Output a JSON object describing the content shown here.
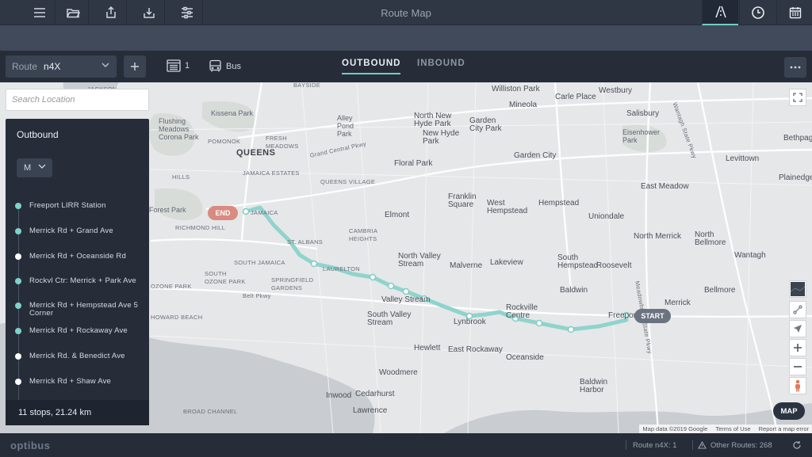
{
  "toolbar": {
    "title": "Route Map",
    "icons": [
      "menu-icon",
      "folder-open-icon",
      "export-icon",
      "download-icon",
      "sliders-icon",
      "route-icon",
      "clock-icon",
      "calendar-icon"
    ]
  },
  "route_bar": {
    "route_label": "Route",
    "route_value": "n4X",
    "trips_count": "1",
    "vehicle_type": "Bus",
    "tabs": [
      "OUTBOUND",
      "INBOUND"
    ],
    "active_tab": "OUTBOUND"
  },
  "search": {
    "placeholder": "Search Location"
  },
  "stops_panel": {
    "title": "Outbound",
    "day": "M",
    "stops": [
      {
        "name": "Freeport LIRR Station",
        "color": "teal"
      },
      {
        "name": "Merrick Rd + Grand Ave",
        "color": "teal"
      },
      {
        "name": "Merrick Rd + Oceanside Rd",
        "color": "white"
      },
      {
        "name": "Rockvl Ctr: Merrick + Park Ave",
        "color": "teal"
      },
      {
        "name": "Merrick Rd + Hempstead Ave 5 Corner",
        "color": "teal"
      },
      {
        "name": "Merrick Rd + Rockaway Ave",
        "color": "teal"
      },
      {
        "name": "Merrick Rd. & Benedict Ave",
        "color": "white"
      },
      {
        "name": "Merrick Rd + Shaw Ave",
        "color": "white"
      }
    ],
    "summary": "11 stops, 21.24 km"
  },
  "map": {
    "end_label": "END",
    "start_label": "START",
    "toggle_label": "MAP",
    "attribution": [
      "Map data ©2019 Google",
      "Terms of Use",
      "Report a map error"
    ],
    "places": [
      {
        "text": "JACKSON",
        "cls": "small"
      },
      {
        "text": "BAYSIDE",
        "cls": "small"
      },
      {
        "text": "Williston Park",
        "cls": "town"
      },
      {
        "text": "Westbury",
        "cls": "town"
      },
      {
        "text": "Mineola",
        "cls": "town"
      },
      {
        "text": "Carle Place",
        "cls": "town"
      },
      {
        "text": "Kissena Park",
        "cls": ""
      },
      {
        "text": "Flushing Meadows Corona Park",
        "cls": ""
      },
      {
        "text": "Alley Pond Park",
        "cls": ""
      },
      {
        "text": "North New Hyde Park",
        "cls": "town"
      },
      {
        "text": "Garden City Park",
        "cls": "town"
      },
      {
        "text": "New Hyde Park",
        "cls": "town"
      },
      {
        "text": "Salisbury",
        "cls": "town"
      },
      {
        "text": "Eisenhower Park",
        "cls": ""
      },
      {
        "text": "Bethpage",
        "cls": "town"
      },
      {
        "text": "POMONOK",
        "cls": "small"
      },
      {
        "text": "FRESH MEADOWS",
        "cls": "small"
      },
      {
        "text": "QUEENS",
        "cls": "bold"
      },
      {
        "text": "JAMAICA ESTATES",
        "cls": "small"
      },
      {
        "text": "Garden City",
        "cls": "town"
      },
      {
        "text": "Floral Park",
        "cls": "town"
      },
      {
        "text": "Levittown",
        "cls": "town"
      },
      {
        "text": "HILLS",
        "cls": "small"
      },
      {
        "text": "QUEENS VILLAGE",
        "cls": "small"
      },
      {
        "text": "East Meadow",
        "cls": "town"
      },
      {
        "text": "Franklin Square",
        "cls": "town"
      },
      {
        "text": "West Hempstead",
        "cls": "town"
      },
      {
        "text": "Hempstead",
        "cls": "town"
      },
      {
        "text": "Uniondale",
        "cls": "town"
      },
      {
        "text": "Plainedge",
        "cls": "town"
      },
      {
        "text": "Forest Park",
        "cls": ""
      },
      {
        "text": "JAMAICA",
        "cls": "small"
      },
      {
        "text": "Elmont",
        "cls": "town"
      },
      {
        "text": "RICHMOND HILL",
        "cls": "small"
      },
      {
        "text": "CAMBRIA HEIGHTS",
        "cls": "small"
      },
      {
        "text": "North Merrick",
        "cls": "town"
      },
      {
        "text": "North Bellmore",
        "cls": "town"
      },
      {
        "text": "ST. ALBANS",
        "cls": "small"
      },
      {
        "text": "Wantagh",
        "cls": "town"
      },
      {
        "text": "North Valley Stream",
        "cls": "town"
      },
      {
        "text": "Malverne",
        "cls": "town"
      },
      {
        "text": "Lakeview",
        "cls": "town"
      },
      {
        "text": "South Hempstead",
        "cls": "town"
      },
      {
        "text": "Roosevelt",
        "cls": "town"
      },
      {
        "text": "SOUTH JAMAICA",
        "cls": "small"
      },
      {
        "text": "LAURELTON",
        "cls": "small"
      },
      {
        "text": "SOUTH OZONE PARK",
        "cls": "small"
      },
      {
        "text": "SPRINGFIELD GARDENS",
        "cls": "small"
      },
      {
        "text": "Baldwin",
        "cls": "town"
      },
      {
        "text": "Bellmore",
        "cls": "town"
      },
      {
        "text": "Valley Stream",
        "cls": "town"
      },
      {
        "text": "Merrick",
        "cls": "town"
      },
      {
        "text": "South Valley Stream",
        "cls": "town"
      },
      {
        "text": "Lynbrook",
        "cls": "town"
      },
      {
        "text": "Rockville Centre",
        "cls": "town"
      },
      {
        "text": "Freeport",
        "cls": "town"
      },
      {
        "text": "Hewlett",
        "cls": "town"
      },
      {
        "text": "East Rockaway",
        "cls": "town"
      },
      {
        "text": "Oceanside",
        "cls": "town"
      },
      {
        "text": "Woodmere",
        "cls": "town"
      },
      {
        "text": "Baldwin Harbor",
        "cls": "town"
      },
      {
        "text": "Inwood",
        "cls": "town"
      },
      {
        "text": "Cedarhurst",
        "cls": "town"
      },
      {
        "text": "Lawrence",
        "cls": "town"
      },
      {
        "text": "BROAD CHANNEL",
        "cls": "small"
      },
      {
        "text": "HOWARD BEACH",
        "cls": "small"
      },
      {
        "text": "OZONE PARK",
        "cls": "small"
      },
      {
        "text": "Grand Central Pkwy",
        "cls": "small"
      },
      {
        "text": "Belt Pkwy",
        "cls": "small"
      },
      {
        "text": "Wantagh State Pkwy",
        "cls": "small"
      },
      {
        "text": "Meadowbrook State Pkwy",
        "cls": "small"
      }
    ]
  },
  "status": {
    "brand": "optibus",
    "route_info": "Route n4X: 1",
    "other_routes": "Other Routes: 268"
  }
}
